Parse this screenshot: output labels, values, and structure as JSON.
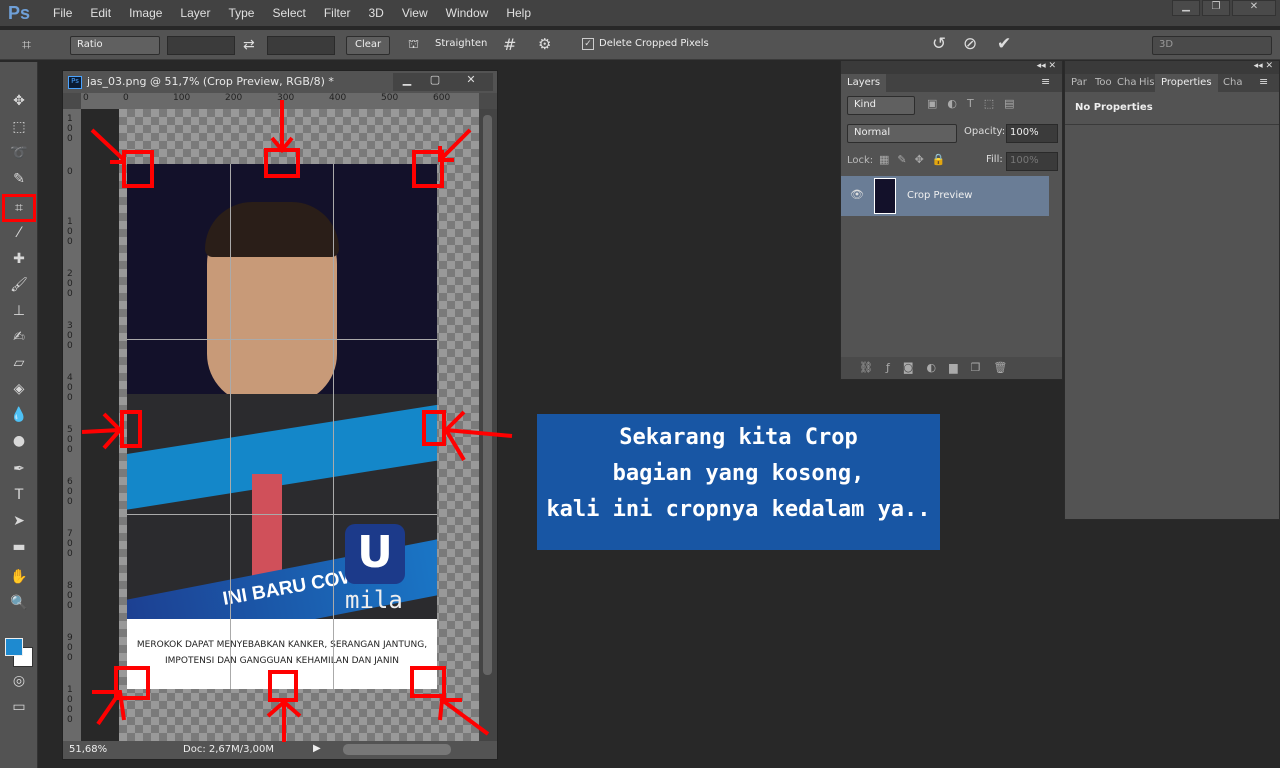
{
  "app": {
    "logo": "Ps"
  },
  "menu": [
    "File",
    "Edit",
    "Image",
    "Layer",
    "Type",
    "Select",
    "Filter",
    "3D",
    "View",
    "Window",
    "Help"
  ],
  "options": {
    "ratio": "Ratio",
    "clear": "Clear",
    "straighten": "Straighten",
    "delete_cropped": "Delete Cropped Pixels",
    "delete_cropped_checked": true,
    "workspace": "3D"
  },
  "document": {
    "title": "jas_03.png @ 51,7% (Crop Preview, RGB/8) *",
    "zoom": "51,68%",
    "doc_size": "Doc: 2,67M/3,00M",
    "ruler_top": [
      "0",
      "0",
      "100",
      "200",
      "300",
      "400",
      "500",
      "600"
    ],
    "ruler_left": [
      "100",
      "0",
      "100",
      "200",
      "300",
      "400",
      "500",
      "600",
      "700",
      "800",
      "900",
      "1000"
    ]
  },
  "image": {
    "banner": "INI BARU COWO",
    "brand": "mila",
    "logo_letter": "U",
    "warning_line1": "MEROKOK DAPAT MENYEBABKAN KANKER, SERANGAN JANTUNG,",
    "warning_line2": "IMPOTENSI DAN GANGGUAN KEHAMILAN DAN JANIN"
  },
  "callout": {
    "line1": "Sekarang kita Crop",
    "line2": "bagian yang kosong,",
    "line3": "kali ini cropnya kedalam ya..",
    "color": "#1856a4"
  },
  "layers": {
    "tab": "Layers",
    "filter": "Kind",
    "blend": "Normal",
    "opacity_label": "Opacity:",
    "opacity": "100%",
    "lock_label": "Lock:",
    "fill_label": "Fill:",
    "fill": "100%",
    "items": [
      {
        "name": "Crop Preview",
        "visible": true
      }
    ]
  },
  "properties": {
    "tabs": [
      "Par",
      "Too",
      "Cha",
      "His",
      "Properties",
      "Cha"
    ],
    "active": "Properties",
    "empty": "No Properties"
  },
  "colors": {
    "annotation": "#ff0000",
    "foreground": "#1e8ad0",
    "background": "#ffffff"
  }
}
